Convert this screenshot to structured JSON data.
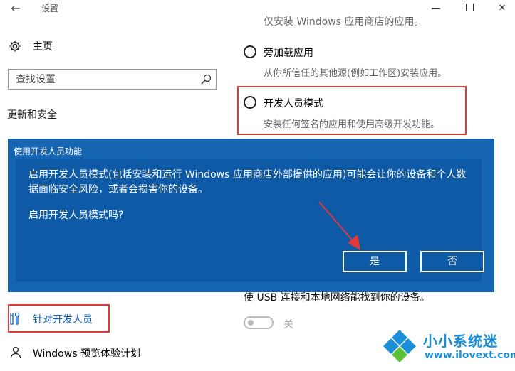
{
  "window": {
    "title": "设置",
    "back_icon": "arrow-left-icon",
    "minimize_icon": "minimize-icon",
    "maximize_icon": "maximize-icon",
    "close_icon": "close-icon"
  },
  "sidebar": {
    "home_label": "主页",
    "home_icon": "gear-icon",
    "search": {
      "placeholder": "查找设置",
      "value": "",
      "icon": "search-icon"
    },
    "section_label": "更新和安全",
    "items": [
      {
        "label": "针对开发人员",
        "icon": "developer-tools-icon",
        "selected": true
      },
      {
        "label": "Windows 预览体验计划",
        "icon": "person-icon",
        "selected": false
      }
    ]
  },
  "content": {
    "top_cut_text": "仅安装 Windows 应用商店的应用。",
    "options": [
      {
        "label": "旁加载应用",
        "description": "从你所信任的其他源(例如工作区)安装应用。",
        "selected": false
      },
      {
        "label": "开发人员模式",
        "description": "安装任何签名的应用和使用高级开发功能。",
        "selected": false
      }
    ],
    "usb_description": "使 USB 连接和本地网络能找到你的设备。",
    "toggle": {
      "state_label": "关",
      "on": false
    }
  },
  "dialog": {
    "title": "使用开发人员功能",
    "message": "启用开发人员模式(包括安装和运行 Windows 应用商店外部提供的应用)可能会让你的设备和个人数据面临安全风险，或者会损害你的设备。",
    "question": "启用开发人员模式吗?",
    "yes_label": "是",
    "no_label": "否"
  },
  "watermark": {
    "title": "小小系统迷",
    "url": "www.ilovext.com"
  },
  "colors": {
    "dialog_bg": "#1665b3",
    "dialog_inner": "#0f5aa6",
    "highlight_red": "#e03a3a",
    "accent_blue": "#0a5ec7",
    "watermark_blue": "#1a8fd8"
  }
}
